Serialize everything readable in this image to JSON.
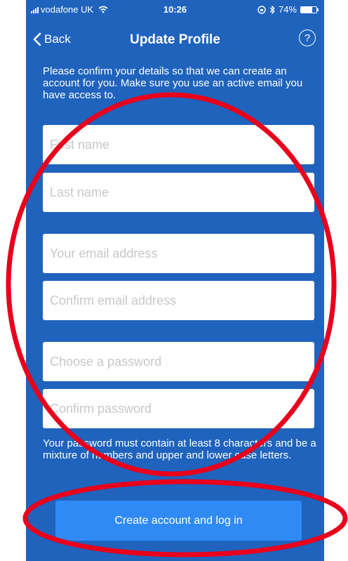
{
  "status_bar": {
    "carrier": "vodafone UK",
    "time": "10:26",
    "battery": "74%",
    "battery_level": 0.74
  },
  "nav": {
    "back_label": "Back",
    "title": "Update Profile",
    "help_glyph": "?"
  },
  "intro_text": "Please confirm your details so that we can create an account for you. Make sure you use an active email you have access to.",
  "fields": {
    "first_name": "First name",
    "last_name": "Last name",
    "email": "Your email address",
    "confirm_email": "Confirm email address",
    "password": "Choose a password",
    "confirm_password": "Confirm password"
  },
  "password_hint": "Your password must contain at least 8 characters and be a mixture of numbers and upper and lower case letters.",
  "create_button_label": "Create account and log in",
  "colors": {
    "background": "#1f63bd",
    "button": "#2f8af5",
    "annotation": "#e8001c"
  },
  "icons": [
    "signal-icon",
    "wifi-icon",
    "lock-rotation-icon",
    "bluetooth-icon",
    "battery-icon",
    "chevron-left-icon",
    "help-icon"
  ]
}
